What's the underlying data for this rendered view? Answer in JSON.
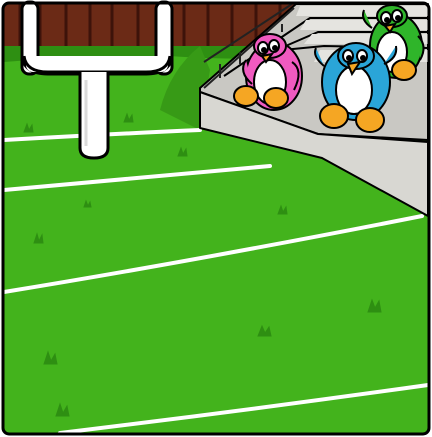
{
  "scene": {
    "description_visible_text": "",
    "palette": {
      "grass": "#43B31C",
      "grass_dark": "#2E8F12",
      "grass_shadow": "#379A16",
      "field_line": "#FFFFFF",
      "fence": "#6B2A16",
      "fence_dark": "#3D130A",
      "bleacher_light": "#E5E4E0",
      "bleacher_mid": "#C9C8C3",
      "bleacher_rail": "#222222",
      "goalpost": "#FFFFFF",
      "outline": "#000000"
    },
    "penguins": [
      {
        "name": "pink-penguin",
        "color": "#F05AC0"
      },
      {
        "name": "blue-penguin",
        "color": "#2AA5D8"
      },
      {
        "name": "green-penguin",
        "color": "#2FB52A"
      }
    ],
    "beak_feet_color": "#F5A623"
  }
}
